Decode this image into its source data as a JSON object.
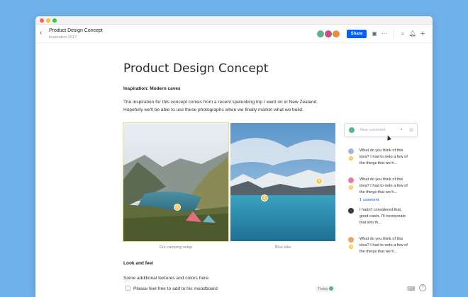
{
  "window": {
    "title": "Product Design Concept",
    "subtitle": "Inspiration 2017"
  },
  "toolbar": {
    "back_icon": "chevron-left-icon",
    "share_label": "Share",
    "icons": [
      "present-icon",
      "more-icon",
      "search-icon",
      "bell-icon",
      "plus-icon"
    ]
  },
  "doc": {
    "heading": "Product Design Concept",
    "section1": "Inspiration: Modern caves",
    "paragraph1": "The inspiration for this concept comes from a recent spelunking trip I went on in New Zealand. Hopefully we'll be able to use these photographs when we finally market what we build.",
    "images": [
      {
        "caption": "Our camping setup",
        "pin": "1"
      },
      {
        "caption": "Blue lake",
        "pins": [
          "2",
          "3"
        ]
      }
    ],
    "section2": "Look and feel",
    "paragraph2": "Some additional textures and colors here.",
    "todo": "Please feel free to add to his moodboard",
    "today_label": "Today"
  },
  "comments": {
    "input_placeholder": "New comment",
    "items": [
      {
        "text": "What do you think of this idea? I had to redo a few of the things that we h...",
        "num": "1",
        "color": "#9fb8d6"
      },
      {
        "text": "What do you think of this idea? I had to redo a few of the things that we h...",
        "num": "2",
        "color": "#e77aa6",
        "link": "1 comment"
      },
      {
        "text": "I hadn't considered that, good catch. I'll incorporate that into th...",
        "num": "",
        "color": "#3a3a3a"
      },
      {
        "text": "What do you think of this idea? I had to redo a few of the things that we h...",
        "num": "3",
        "color": "#f0a35e"
      }
    ]
  },
  "colors": {
    "accent": "#0061fe",
    "background": "#6fb1ea",
    "pin": "#f7c948"
  }
}
